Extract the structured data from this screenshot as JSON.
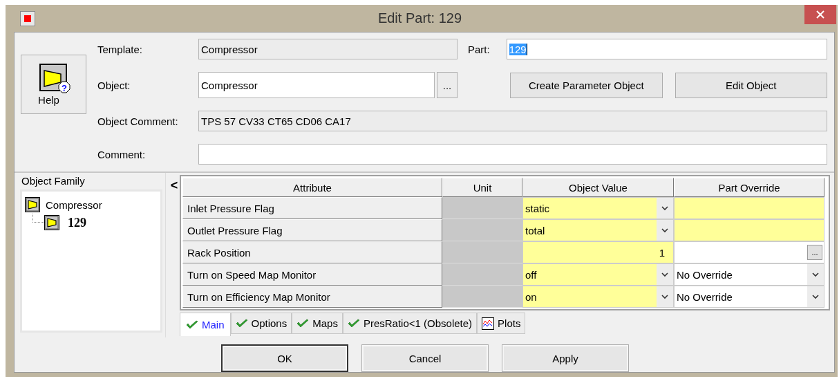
{
  "window": {
    "title": "Edit Part: 129"
  },
  "help_button": {
    "label": "Help",
    "badge": "?"
  },
  "form": {
    "template": {
      "label": "Template:",
      "value": "Compressor"
    },
    "part": {
      "label": "Part:",
      "value": "129",
      "selected": true
    },
    "object": {
      "label": "Object:",
      "value": "Compressor",
      "browse": "..."
    },
    "object_comment": {
      "label": "Object Comment:",
      "value": "TPS 57 CV33 CT65 CD06 CA17"
    },
    "comment": {
      "label": "Comment:"
    },
    "buttons": [
      "Create Parameter Object",
      "Edit Object"
    ]
  },
  "object_family": {
    "title": "Object Family",
    "collapse": "<",
    "tree": [
      {
        "label": "Compressor",
        "current": false,
        "children": [
          {
            "label": "129",
            "current": true
          }
        ]
      }
    ]
  },
  "table": {
    "columns": [
      "Attribute",
      "Unit",
      "Object Value",
      "Part Override"
    ],
    "rows": [
      {
        "attribute": "Inlet Pressure Flag",
        "object_value": {
          "kind": "dropdown",
          "value": "static"
        },
        "part_override": {
          "kind": "blank"
        }
      },
      {
        "attribute": "Outlet Pressure Flag",
        "object_value": {
          "kind": "dropdown",
          "value": "total"
        },
        "part_override": {
          "kind": "blank"
        }
      },
      {
        "attribute": "Rack Position",
        "object_value": {
          "kind": "number",
          "value": "1"
        },
        "part_override": {
          "kind": "browse",
          "value": "..."
        }
      },
      {
        "attribute": "Turn on Speed Map Monitor",
        "object_value": {
          "kind": "dropdown",
          "value": "off"
        },
        "part_override": {
          "kind": "dropdown",
          "value": "No Override"
        }
      },
      {
        "attribute": "Turn on Efficiency Map Monitor",
        "object_value": {
          "kind": "dropdown",
          "value": "on"
        },
        "part_override": {
          "kind": "dropdown",
          "value": "No Override"
        }
      }
    ]
  },
  "tabs": [
    {
      "label": "Main",
      "kind": "check",
      "selected": true
    },
    {
      "label": "Options",
      "kind": "check",
      "selected": false
    },
    {
      "label": "Maps",
      "kind": "check",
      "selected": false
    },
    {
      "label": "PresRatio<1 (Obsolete)",
      "kind": "check",
      "selected": false
    },
    {
      "label": "Plots",
      "kind": "plot",
      "selected": false
    }
  ],
  "buttons": [
    {
      "label": "OK",
      "default": true
    },
    {
      "label": "Cancel",
      "default": false
    },
    {
      "label": "Apply",
      "default": false
    }
  ]
}
